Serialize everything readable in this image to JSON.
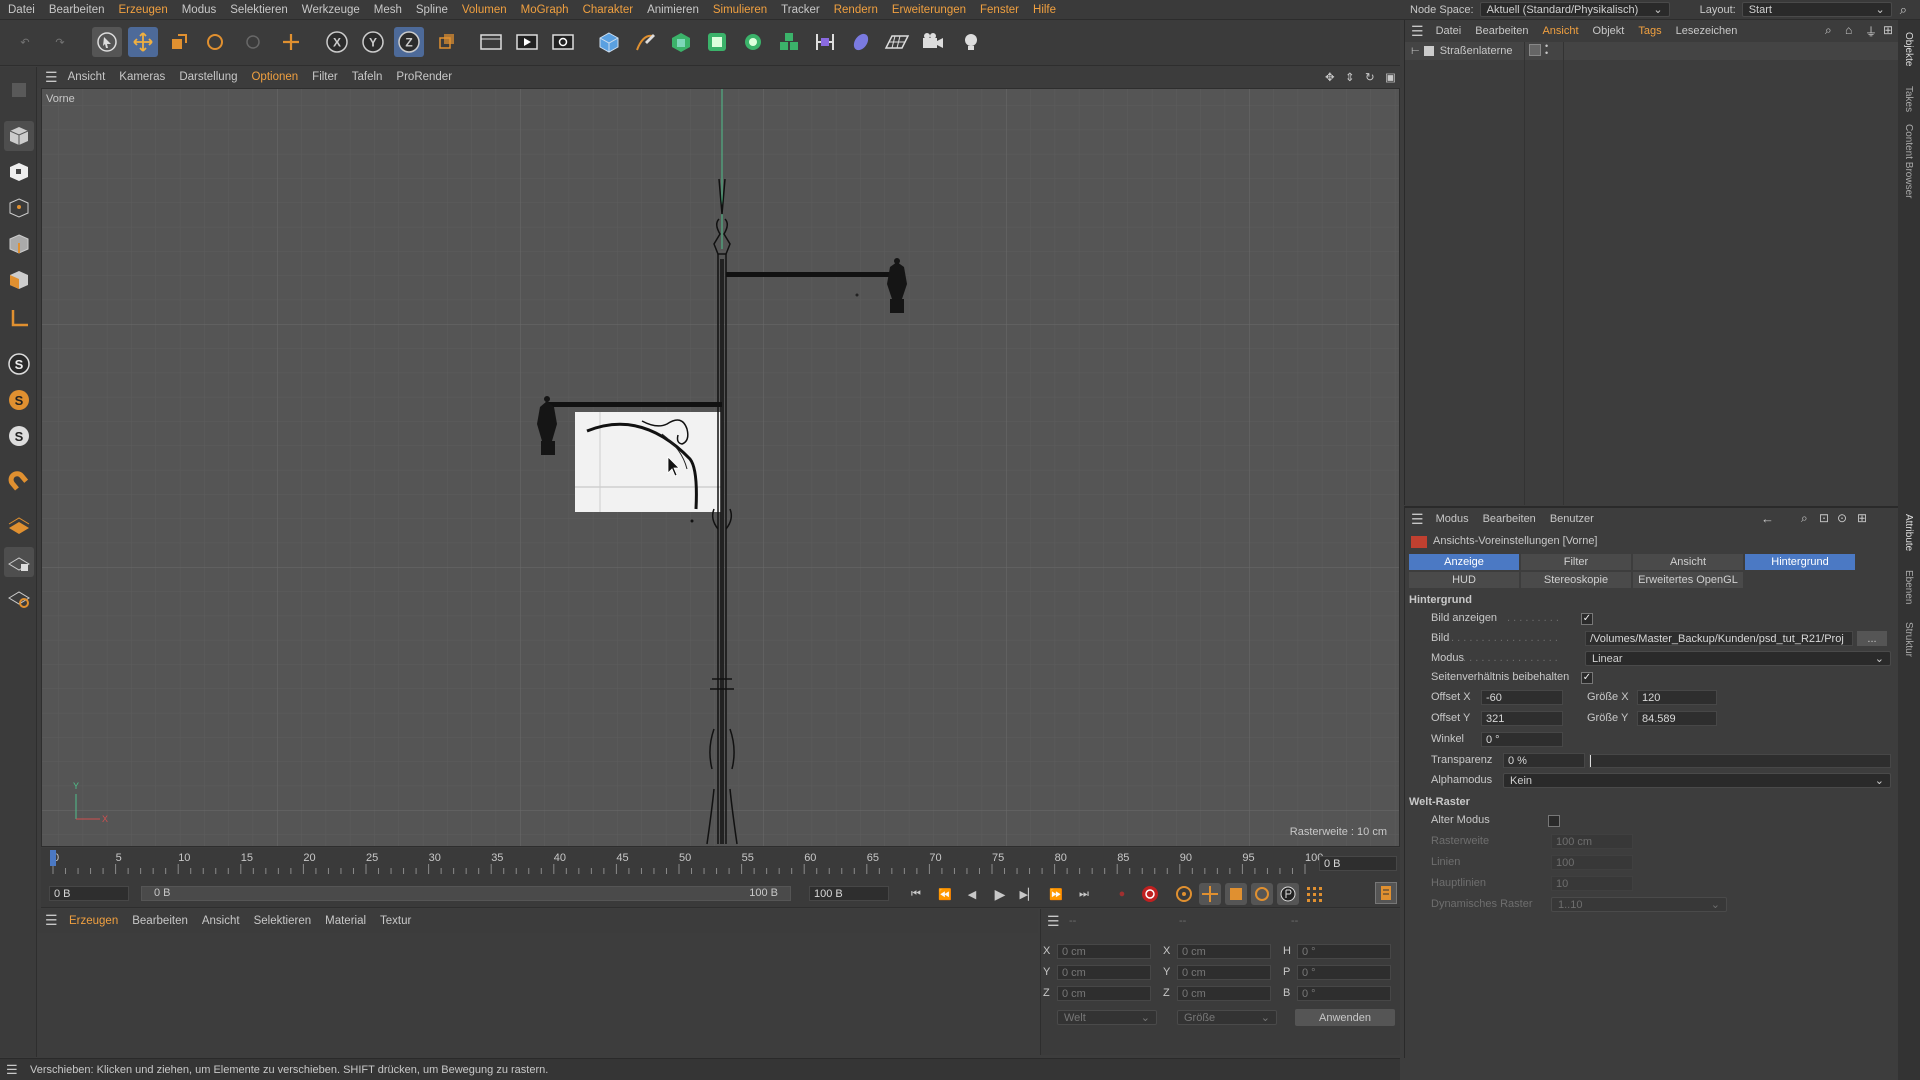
{
  "menu": [
    "Datei",
    "Bearbeiten",
    "Erzeugen",
    "Modus",
    "Selektieren",
    "Werkzeuge",
    "Mesh",
    "Spline",
    "Volumen",
    "MoGraph",
    "Charakter",
    "Animieren",
    "Simulieren",
    "Tracker",
    "Rendern",
    "Erweiterungen",
    "Fenster",
    "Hilfe"
  ],
  "top_right": {
    "node_space_label": "Node Space:",
    "node_space_value": "Aktuell (Standard/Physikalisch)",
    "layout_label": "Layout:",
    "layout_value": "Start"
  },
  "toolbar_axes": {
    "x": "X",
    "y": "Y",
    "z": "Z"
  },
  "left_tools": {
    "s1": "S",
    "s2": "S",
    "s3": "S"
  },
  "viewport_menu": [
    "Ansicht",
    "Kameras",
    "Darstellung",
    "Optionen",
    "Filter",
    "Tafeln",
    "ProRender"
  ],
  "viewport": {
    "view_name": "Vorne",
    "grid_label": "Rasterweite : 10 cm",
    "axis_y": "Y",
    "axis_x": "X"
  },
  "timeline": {
    "ticks": [
      "0",
      "5",
      "10",
      "15",
      "20",
      "25",
      "30",
      "35",
      "40",
      "45",
      "50",
      "55",
      "60",
      "65",
      "70",
      "75",
      "80",
      "85",
      "90",
      "95",
      "100"
    ],
    "current_frame": "0 B"
  },
  "transport": {
    "start": "0 B",
    "range_start": "0 B",
    "range_end": "100 B",
    "end": "100 B"
  },
  "material_menu": [
    "Erzeugen",
    "Bearbeiten",
    "Ansicht",
    "Selektieren",
    "Material",
    "Textur"
  ],
  "coords": {
    "header": [
      "--",
      "--",
      "--"
    ],
    "rows": [
      {
        "a": "X",
        "av": "0 cm",
        "b": "X",
        "bv": "0 cm",
        "c": "H",
        "cv": "0 °"
      },
      {
        "a": "Y",
        "av": "0 cm",
        "b": "Y",
        "bv": "0 cm",
        "c": "P",
        "cv": "0 °"
      },
      {
        "a": "Z",
        "av": "0 cm",
        "b": "Z",
        "bv": "0 cm",
        "c": "B",
        "cv": "0 °"
      }
    ],
    "mode": "Welt",
    "size": "Größe",
    "apply": "Anwenden"
  },
  "status": "Verschieben: Klicken und ziehen, um Elemente zu verschieben. SHIFT drücken, um Bewegung zu rastern.",
  "objects": {
    "menu": [
      "Datei",
      "Bearbeiten",
      "Ansicht",
      "Objekt",
      "Tags",
      "Lesezeichen"
    ],
    "item": "Straßenlaterne"
  },
  "side_tabs": {
    "top": [
      "Objekte",
      "Takes",
      "Content Browser"
    ],
    "bottom": [
      "Attribute",
      "Ebenen",
      "Struktur"
    ]
  },
  "attributes": {
    "menu": [
      "Modus",
      "Bearbeiten",
      "Benutzer"
    ],
    "title": "Ansichts-Voreinstellungen [Vorne]",
    "tabs_row1": [
      "Anzeige",
      "Filter",
      "Ansicht",
      "Hintergrund"
    ],
    "tabs_row2": [
      "HUD",
      "Stereoskopie",
      "Erweitertes OpenGL"
    ],
    "section_bg": "Hintergrund",
    "bild_anzeigen": "Bild anzeigen",
    "bild": "Bild",
    "bild_path": "/Volumes/Master_Backup/Kunden/psd_tut_R21/Proj",
    "browse": "...",
    "modus": "Modus",
    "modus_value": "Linear",
    "seiten": "Seitenverhältnis beibehalten",
    "offset_x": "Offset X",
    "offset_x_val": "-60",
    "groesse_x": "Größe X",
    "groesse_x_val": "120",
    "offset_y": "Offset Y",
    "offset_y_val": "321",
    "groesse_y": "Größe Y",
    "groesse_y_val": "84.589",
    "winkel": "Winkel",
    "winkel_val": "0 °",
    "transparenz": "Transparenz",
    "transparenz_val": "0 %",
    "alphamodus": "Alphamodus",
    "alphamodus_val": "Kein",
    "section_grid": "Welt-Raster",
    "alter_modus": "Alter Modus",
    "rasterweite": "Rasterweite",
    "rasterweite_val": "100 cm",
    "linien": "Linien",
    "linien_val": "100",
    "hauptlinien": "Hauptlinien",
    "hauptlinien_val": "10",
    "dyn": "Dynamisches Raster",
    "dyn_val": "1..10",
    "check": "✓"
  },
  "colors": {
    "accent": "#f0a040",
    "selected_tab": "#4b79c4",
    "viewport_bg": "#555555",
    "panel": "#3d3d3d"
  }
}
